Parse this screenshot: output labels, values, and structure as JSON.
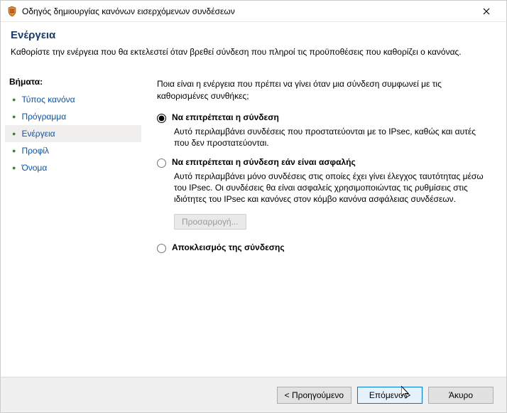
{
  "window": {
    "title": "Οδηγός δημιουργίας κανόνων εισερχόμενων συνδέσεων"
  },
  "header": {
    "title": "Ενέργεια",
    "description": "Καθορίστε την ενέργεια που θα εκτελεστεί όταν βρεθεί σύνδεση που πληροί τις προϋποθέσεις που καθορίζει ο κανόνας."
  },
  "sidebar": {
    "heading": "Βήματα:",
    "items": [
      {
        "label": "Τύπος κανόνα"
      },
      {
        "label": "Πρόγραμμα"
      },
      {
        "label": "Ενέργεια"
      },
      {
        "label": "Προφίλ"
      },
      {
        "label": "Όνομα"
      }
    ],
    "current_index": 2
  },
  "main": {
    "prompt": "Ποια είναι η ενέργεια που πρέπει να γίνει όταν μια σύνδεση συμφωνεί με τις καθορισμένες συνθήκες;",
    "options": [
      {
        "label": "Να επιτρέπεται η σύνδεση",
        "description": "Αυτό περιλαμβάνει συνδέσεις που προστατεύονται με το IPsec, καθώς και αυτές που δεν προστατεύονται.",
        "selected": true
      },
      {
        "label": "Να επιτρέπεται η σύνδεση εάν είναι ασφαλής",
        "description": "Αυτό περιλαμβάνει μόνο συνδέσεις στις οποίες έχει γίνει έλεγχος ταυτότητας μέσω του IPsec. Οι συνδέσεις θα είναι ασφαλείς χρησιμοποιώντας τις ρυθμίσεις στις ιδιότητες του IPsec και κανόνες στον κόμβο κανόνα ασφάλειας συνδέσεων.",
        "selected": false
      },
      {
        "label": "Αποκλεισμός της σύνδεσης",
        "description": "",
        "selected": false
      }
    ],
    "customize_label": "Προσαρμογή..."
  },
  "footer": {
    "back": "< Προηγούμενο",
    "next": "Επόμενο >",
    "cancel": "Άκυρο"
  }
}
